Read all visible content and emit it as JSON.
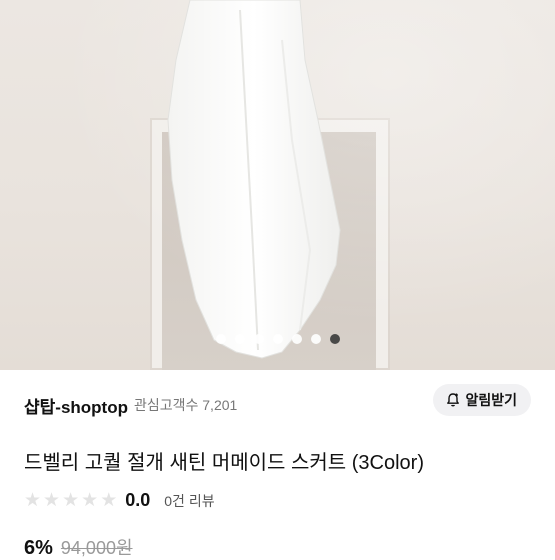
{
  "product_image": {
    "carousel_total": 7,
    "carousel_active_index": 7
  },
  "shop": {
    "name": "샵탑-shoptop",
    "followers_label": "관심고객수 7,201",
    "notify_button_label": "알림받기",
    "notify_icon": "bell-plus-icon"
  },
  "product": {
    "title": "드벨리 고퀄 절개 새틴 머메이드 스커트 (3Color)",
    "rating_value": "0.0",
    "rating_stars": 0,
    "reviews_label": "0건 리뷰",
    "discount": "6%",
    "original_price": "94,000원"
  },
  "colors": {
    "dot_active": "#3a3a3a",
    "button_bg": "#f1f1f3",
    "star_empty": "#e3e3e3"
  }
}
